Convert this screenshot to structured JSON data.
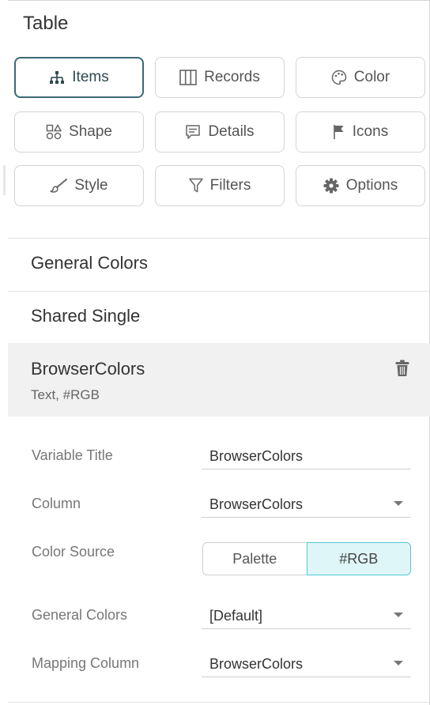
{
  "panel": {
    "title": "Table"
  },
  "buttons": [
    {
      "label": "Items",
      "icon": "hierarchy-icon",
      "active": true
    },
    {
      "label": "Records",
      "icon": "columns-icon",
      "active": false
    },
    {
      "label": "Color",
      "icon": "palette-icon",
      "active": false
    },
    {
      "label": "Shape",
      "icon": "shapes-icon",
      "active": false
    },
    {
      "label": "Details",
      "icon": "comment-icon",
      "active": false
    },
    {
      "label": "Icons",
      "icon": "flag-icon",
      "active": false
    },
    {
      "label": "Style",
      "icon": "brush-icon",
      "active": false
    },
    {
      "label": "Filters",
      "icon": "funnel-icon",
      "active": false
    },
    {
      "label": "Options",
      "icon": "gear-icon",
      "active": false
    }
  ],
  "color_list": [
    {
      "label": "General Colors"
    },
    {
      "label": "Shared Single"
    },
    {
      "label": "BrowserColors",
      "sub": "Text, #RGB",
      "selected": true
    }
  ],
  "form": {
    "variable_title": {
      "label": "Variable Title",
      "value": "BrowserColors"
    },
    "column": {
      "label": "Column",
      "value": "BrowserColors"
    },
    "color_source": {
      "label": "Color Source",
      "options": [
        "Palette",
        "#RGB"
      ],
      "selected": "#RGB"
    },
    "general_colors": {
      "label": "General Colors",
      "value": "[Default]"
    },
    "mapping_column": {
      "label": "Mapping Column",
      "value": "BrowserColors"
    }
  },
  "colors": {
    "active_border": "#3a6a75",
    "segment_selected_bg": "#dff6f8",
    "segment_selected_border": "#52c7d6",
    "selected_row_bg": "#f1f1f1"
  }
}
